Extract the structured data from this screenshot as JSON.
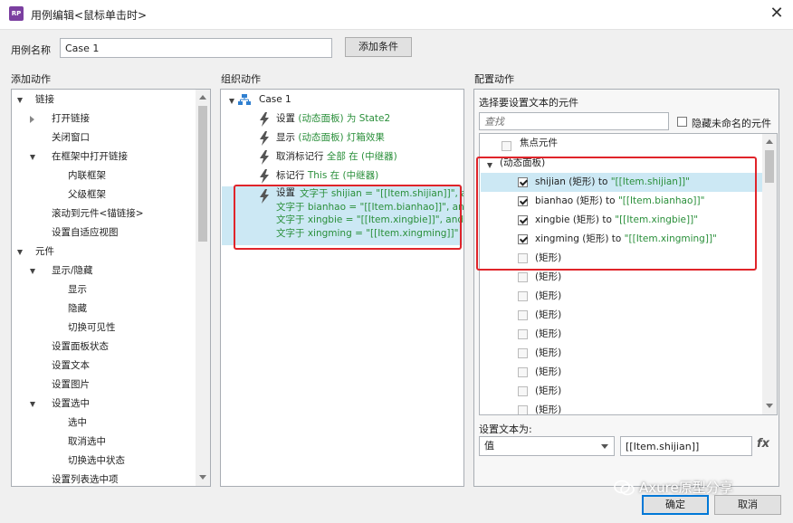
{
  "window": {
    "title": "用例编辑<鼠标单击时>",
    "icon_text": "RP"
  },
  "case_name": {
    "label": "用例名称",
    "value": "Case 1",
    "add_condition": "添加条件"
  },
  "add_actions": {
    "header": "添加动作",
    "items": [
      {
        "label": "链接",
        "level": 0,
        "expand": "open"
      },
      {
        "label": "打开链接",
        "level": 1,
        "expand": "closed"
      },
      {
        "label": "关闭窗口",
        "level": 1,
        "expand": "none"
      },
      {
        "label": "在框架中打开链接",
        "level": 1,
        "expand": "open"
      },
      {
        "label": "内联框架",
        "level": 2,
        "expand": "none"
      },
      {
        "label": "父级框架",
        "level": 2,
        "expand": "none"
      },
      {
        "label": "滚动到元件<锚链接>",
        "level": 1,
        "expand": "none"
      },
      {
        "label": "设置自适应视图",
        "level": 1,
        "expand": "none"
      },
      {
        "label": "元件",
        "level": 0,
        "expand": "open"
      },
      {
        "label": "显示/隐藏",
        "level": 1,
        "expand": "open"
      },
      {
        "label": "显示",
        "level": 2,
        "expand": "none"
      },
      {
        "label": "隐藏",
        "level": 2,
        "expand": "none"
      },
      {
        "label": "切换可见性",
        "level": 2,
        "expand": "none"
      },
      {
        "label": "设置面板状态",
        "level": 1,
        "expand": "none"
      },
      {
        "label": "设置文本",
        "level": 1,
        "expand": "none"
      },
      {
        "label": "设置图片",
        "level": 1,
        "expand": "none"
      },
      {
        "label": "设置选中",
        "level": 1,
        "expand": "open"
      },
      {
        "label": "选中",
        "level": 2,
        "expand": "none"
      },
      {
        "label": "取消选中",
        "level": 2,
        "expand": "none"
      },
      {
        "label": "切换选中状态",
        "level": 2,
        "expand": "none"
      },
      {
        "label": "设置列表选中项",
        "level": 1,
        "expand": "none"
      }
    ]
  },
  "organize": {
    "header": "组织动作",
    "case_label": "Case 1",
    "actions": [
      {
        "plain": "设置 ",
        "green": "(动态面板) 为 State2"
      },
      {
        "plain": "显示 ",
        "green": "(动态面板) 灯箱效果"
      },
      {
        "plain": "取消标记行 ",
        "green": "全部 在 (中继器)"
      },
      {
        "plain": "标记行 ",
        "green": "This 在 (中继器)"
      }
    ],
    "selected_action": {
      "plain": "设置 ",
      "lines": [
        "文字于 shijian = \"[[Item.shijian]]\", and",
        "文字于 bianhao = \"[[Item.bianhao]]\", and",
        "文字于 xingbie = \"[[Item.xingbie]]\", and",
        "文字于 xingming = \"[[Item.xingming]]\""
      ]
    }
  },
  "config": {
    "header": "配置动作",
    "subheader": "选择要设置文本的元件",
    "search_placeholder": "查找",
    "hide_unnamed": "隐藏未命名的元件",
    "focus_widget": "焦点元件",
    "panel_node": "(动态面板)",
    "checked_items": [
      {
        "name": "shijian (矩形) to ",
        "value": "\"[[Item.shijian]]\""
      },
      {
        "name": "bianhao (矩形) to ",
        "value": "\"[[Item.bianhao]]\""
      },
      {
        "name": "xingbie (矩形) to ",
        "value": "\"[[Item.xingbie]]\""
      },
      {
        "name": "xingming (矩形) to ",
        "value": "\"[[Item.xingming]]\""
      }
    ],
    "unchecked_label": "(矩形)",
    "set_text_label": "设置文本为:",
    "type_select": "值",
    "value_input": "[[Item.shijian]]",
    "fx_label": "fx"
  },
  "buttons": {
    "ok": "确定",
    "cancel": "取消"
  },
  "watermark": "Axure原型分享",
  "colors": {
    "selection": "#cce8f4",
    "highlight_red": "#e0242a",
    "action_green": "#2a8f3a",
    "bolt": "#555555"
  }
}
